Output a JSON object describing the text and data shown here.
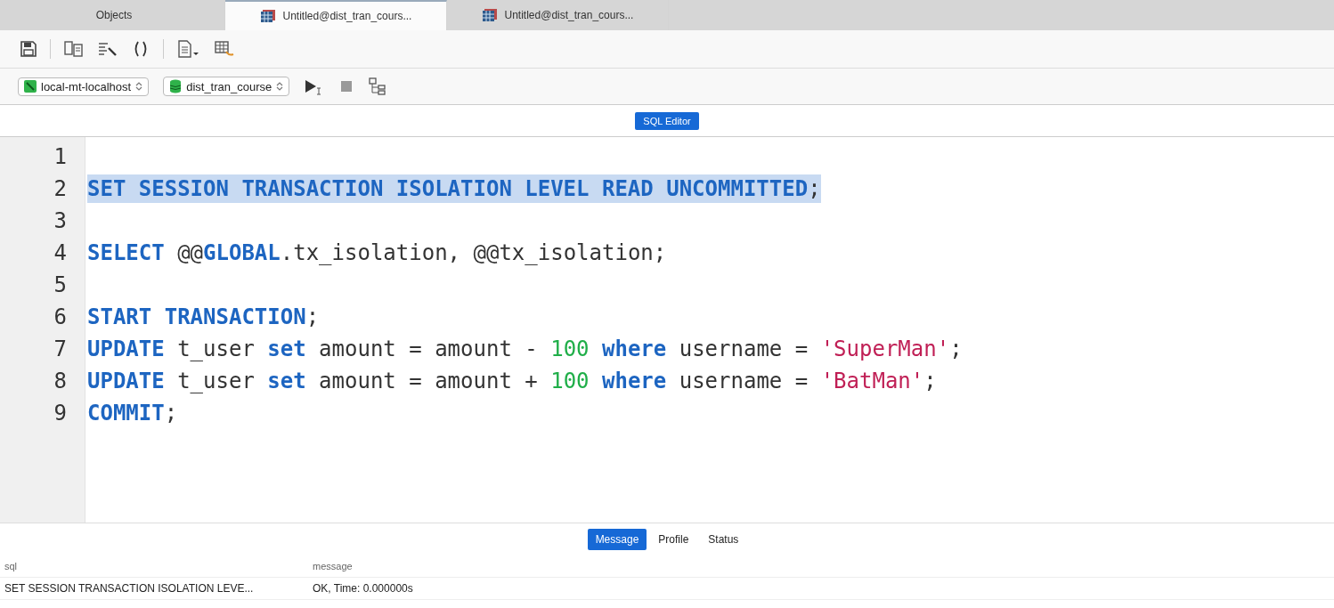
{
  "tabs": [
    {
      "label": "Objects",
      "kind": "plain",
      "selected": false
    },
    {
      "label": "Untitled@dist_tran_cours...",
      "kind": "query",
      "selected": true
    },
    {
      "label": "Untitled@dist_tran_cours...",
      "kind": "query",
      "selected": false
    }
  ],
  "connection": {
    "value": "local-mt-localhost"
  },
  "database": {
    "value": "dist_tran_course"
  },
  "editor_mode": {
    "label": "SQL Editor"
  },
  "code_lines": [
    {
      "number": "1",
      "selected": false
    },
    {
      "number": "2",
      "selected": true,
      "tokens": [
        {
          "kind": "kw",
          "text": "SET SESSION TRANSACTION ISOLATION LEVEL READ UNCOMMITTED"
        },
        {
          "kind": "plain",
          "text": ";"
        }
      ]
    },
    {
      "number": "3",
      "selected": false
    },
    {
      "number": "4",
      "selected": false,
      "tokens": [
        {
          "kind": "kw",
          "text": "SELECT"
        },
        {
          "kind": "plain",
          "text": " @@"
        },
        {
          "kind": "kw",
          "text": "GLOBAL"
        },
        {
          "kind": "plain",
          "text": ".tx_isolation, @@tx_isolation;"
        }
      ]
    },
    {
      "number": "5",
      "selected": false
    },
    {
      "number": "6",
      "selected": false,
      "tokens": [
        {
          "kind": "kw",
          "text": "START TRANSACTION"
        },
        {
          "kind": "plain",
          "text": ";"
        }
      ]
    },
    {
      "number": "7",
      "selected": false,
      "tokens": [
        {
          "kind": "kw",
          "text": "UPDATE"
        },
        {
          "kind": "plain",
          "text": " t_user "
        },
        {
          "kind": "kw",
          "text": "set"
        },
        {
          "kind": "plain",
          "text": " amount = amount - "
        },
        {
          "kind": "num",
          "text": "100"
        },
        {
          "kind": "kw",
          "text": " where"
        },
        {
          "kind": "plain",
          "text": " username = "
        },
        {
          "kind": "str",
          "text": "'SuperMan'"
        },
        {
          "kind": "plain",
          "text": ";"
        }
      ]
    },
    {
      "number": "8",
      "selected": false,
      "tokens": [
        {
          "kind": "kw",
          "text": "UPDATE"
        },
        {
          "kind": "plain",
          "text": " t_user "
        },
        {
          "kind": "kw",
          "text": "set"
        },
        {
          "kind": "plain",
          "text": " amount = amount + "
        },
        {
          "kind": "num",
          "text": "100"
        },
        {
          "kind": "kw",
          "text": " where"
        },
        {
          "kind": "plain",
          "text": " username = "
        },
        {
          "kind": "str",
          "text": "'BatMan'"
        },
        {
          "kind": "plain",
          "text": ";"
        }
      ]
    },
    {
      "number": "9",
      "selected": false,
      "tokens": [
        {
          "kind": "kw",
          "text": "COMMIT"
        },
        {
          "kind": "plain",
          "text": ";"
        }
      ]
    }
  ],
  "result_tabs": [
    {
      "label": "Message",
      "selected": true
    },
    {
      "label": "Profile",
      "selected": false
    },
    {
      "label": "Status",
      "selected": false
    }
  ],
  "result_table": {
    "columns": [
      "sql",
      "message"
    ],
    "rows": [
      [
        "SET SESSION TRANSACTION ISOLATION LEVE...",
        "OK, Time: 0.000000s"
      ]
    ]
  }
}
